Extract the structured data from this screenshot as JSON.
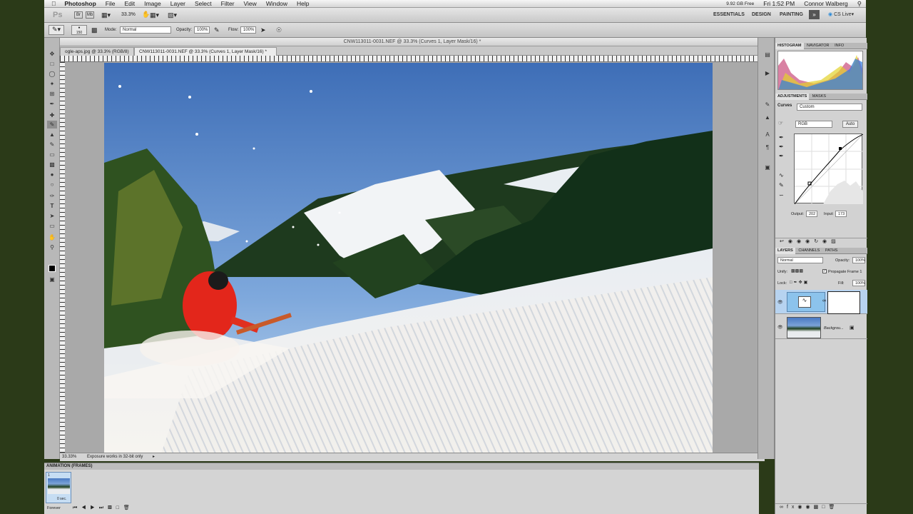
{
  "menubar": {
    "app": "Photoshop",
    "items": [
      "File",
      "Edit",
      "Image",
      "Layer",
      "Select",
      "Filter",
      "View",
      "Window",
      "Help"
    ],
    "status_right": [
      "9.92 GB Free",
      "Fri 1:52 PM",
      "Connor Walberg"
    ]
  },
  "appbar": {
    "logo": "Ps",
    "zoom": "33.3%",
    "workspaces": [
      "ESSENTIALS",
      "DESIGN",
      "PAINTING"
    ],
    "cslive": "CS Live"
  },
  "options": {
    "brush_size": "150",
    "mode_label": "Mode:",
    "mode_value": "Normal",
    "opacity_label": "Opacity:",
    "opacity_value": "100%",
    "flow_label": "Flow:",
    "flow_value": "100%"
  },
  "document": {
    "title": "CNW113011-0031.NEF @ 33.3% (Curves 1, Layer Mask/16) *",
    "tabs": [
      "ogle-aps.jpg @ 33.3% (RGB/8)",
      "CNW113011-0031.NEF @ 33.3% (Curves 1, Layer Mask/16) *"
    ],
    "status_zoom": "33.33%",
    "status_msg": "Exposure works in 32-bit only"
  },
  "panels": {
    "top_tabs": [
      "HISTOGRAM",
      "NAVIGATOR",
      "INFO"
    ],
    "adj_tabs": [
      "ADJUSTMENTS",
      "MASKS"
    ],
    "curves_label": "Curves",
    "preset": "Custom",
    "channel": "RGB",
    "auto": "Auto",
    "output_label": "Output:",
    "output_value": "202",
    "input_label": "Input:",
    "input_value": "173",
    "layer_tabs": [
      "LAYERS",
      "CHANNELS",
      "PATHS"
    ],
    "blend": "Normal",
    "opacity_label": "Opacity:",
    "opacity_value": "100%",
    "unify_label": "Unify:",
    "propagate": "Propagate Frame 1",
    "lock_label": "Lock:",
    "fill_label": "Fill:",
    "fill_value": "100%",
    "layer_bg": "Backgrou..."
  },
  "animation": {
    "title": "ANIMATION (FRAMES)",
    "frame_num": "1",
    "frame_time": "0 sec.",
    "loop": "Forever"
  }
}
